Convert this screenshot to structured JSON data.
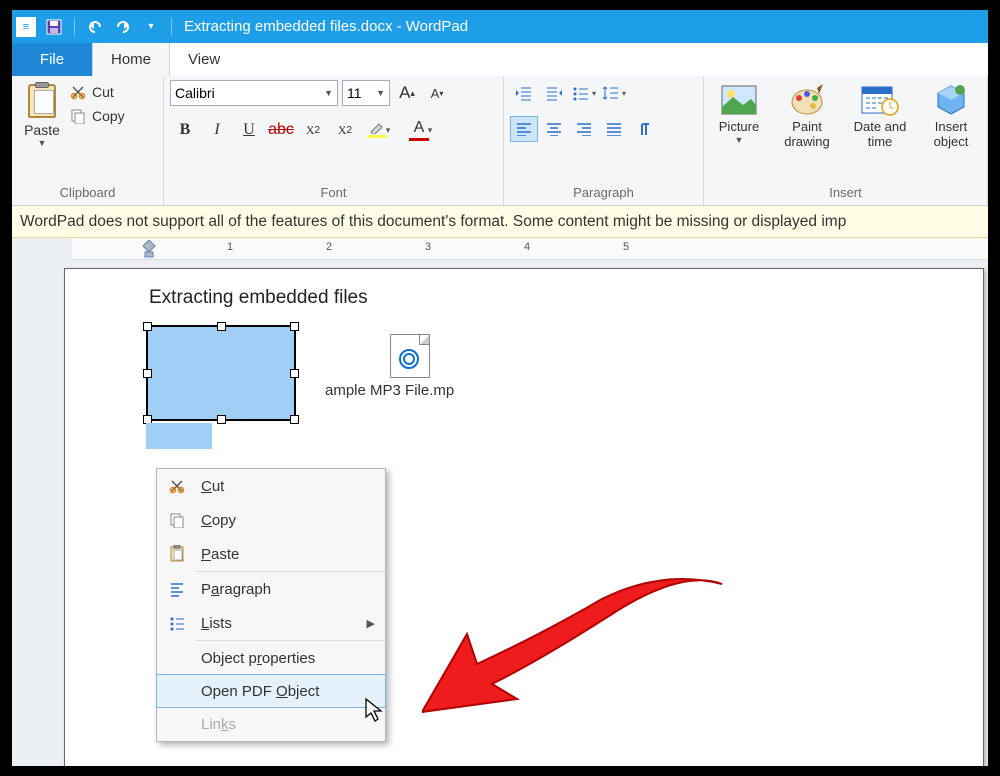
{
  "titlebar": {
    "title": "Extracting embedded files.docx - WordPad"
  },
  "tabs": {
    "file": "File",
    "home": "Home",
    "view": "View"
  },
  "clipboard": {
    "paste": "Paste",
    "cut": "Cut",
    "copy": "Copy",
    "group": "Clipboard"
  },
  "font": {
    "group": "Font",
    "name": "Calibri",
    "size": "11",
    "grow": "A",
    "shrink": "A",
    "bold": "B",
    "italic": "I",
    "under": "U",
    "strike": "abc",
    "sub": "X₂",
    "sup": "X²",
    "fontcolor": "A"
  },
  "paragraph": {
    "group": "Paragraph"
  },
  "insert": {
    "group": "Insert",
    "picture": "Picture",
    "paint": "Paint drawing",
    "datetime": "Date and time",
    "object": "Insert object"
  },
  "warning": "WordPad does not support all of the features of this document's format. Some content might be missing or displayed imp",
  "ruler_marks": [
    "1",
    "2",
    "3",
    "4",
    "5"
  ],
  "document": {
    "heading": "Extracting embedded files",
    "mp3_label": "ample MP3 File.mp"
  },
  "context_menu": {
    "cut": "Cut",
    "copy": "Copy",
    "paste": "Paste",
    "paragraph": "Paragraph",
    "lists": "Lists",
    "obj_props": "Object properties",
    "open_obj": "Open PDF Object",
    "links": "Links"
  }
}
